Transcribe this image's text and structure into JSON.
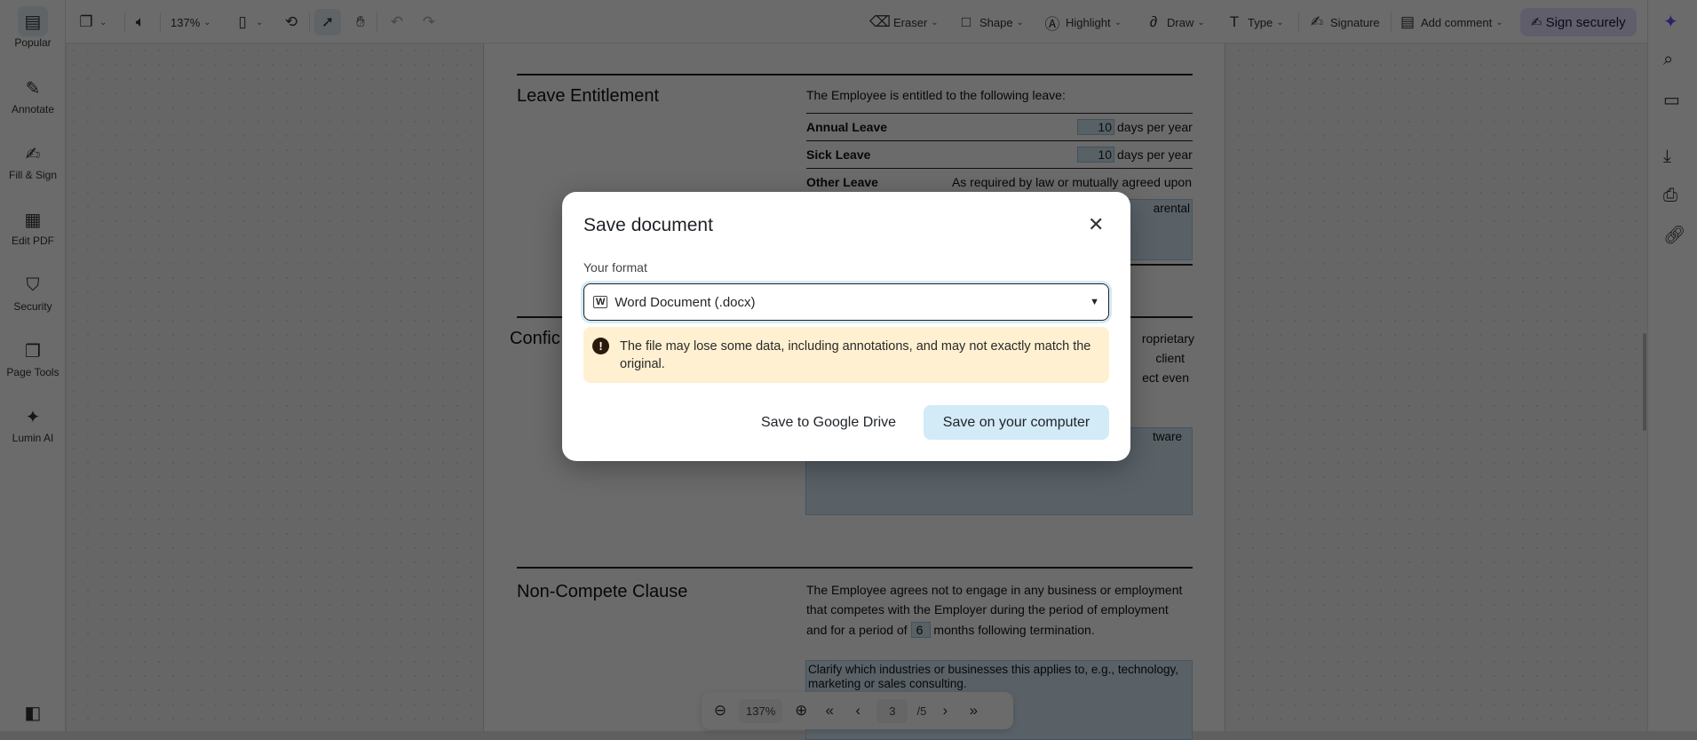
{
  "toolbar": {
    "zoom": "137%",
    "tools": [
      {
        "label": "Eraser"
      },
      {
        "label": "Shape"
      },
      {
        "label": "Highlight"
      },
      {
        "label": "Draw"
      },
      {
        "label": "Type"
      },
      {
        "label": "Signature"
      },
      {
        "label": "Add comment"
      }
    ],
    "sign_label": "Sign securely",
    "accent": "#e5e0ff"
  },
  "sidebar": {
    "items": [
      {
        "label": "Popular"
      },
      {
        "label": "Annotate"
      },
      {
        "label": "Fill & Sign"
      },
      {
        "label": "Edit PDF"
      },
      {
        "label": "Security"
      },
      {
        "label": "Page Tools"
      },
      {
        "label": "Lumin AI"
      }
    ]
  },
  "document": {
    "leave": {
      "title": "Leave Entitlement",
      "intro": "The Employee is entitled to the following leave:",
      "annual_label": "Annual Leave",
      "annual_value": "10",
      "sick_label": "Sick Leave",
      "sick_value": "10",
      "unit": "days per year",
      "other_label": "Other Leave",
      "other_value": "As required by law or mutually agreed upon",
      "box_fragment": "arental"
    },
    "conf": {
      "title_fragment": "Confic",
      "l1": "roprietary",
      "l2": "client",
      "l3": "ect even",
      "box_fragment": "tware"
    },
    "noncompete": {
      "title": "Non-Compete Clause",
      "l1": "The Employee agrees not to engage in any business or employment",
      "l2": "that competes with the Employer during the period of employment",
      "l3a": "and for a period of",
      "months": "6",
      "l3b": "months following termination.",
      "box": "Clarify which industries or businesses this applies to, e.g., technology, marketing or sales consulting."
    }
  },
  "dialog": {
    "title": "Save document",
    "format_label": "Your format",
    "format_value": "Word Document (.docx)",
    "warning": "The file may lose some data, including annotations, and may not exactly match the original.",
    "google_drive": "Save to Google Drive",
    "save_computer": "Save on your computer",
    "warning_bg": "#fff0d1",
    "primary_bg": "#d3eaf7"
  },
  "pager": {
    "zoom": "137%",
    "page": "3",
    "total": "/5"
  }
}
